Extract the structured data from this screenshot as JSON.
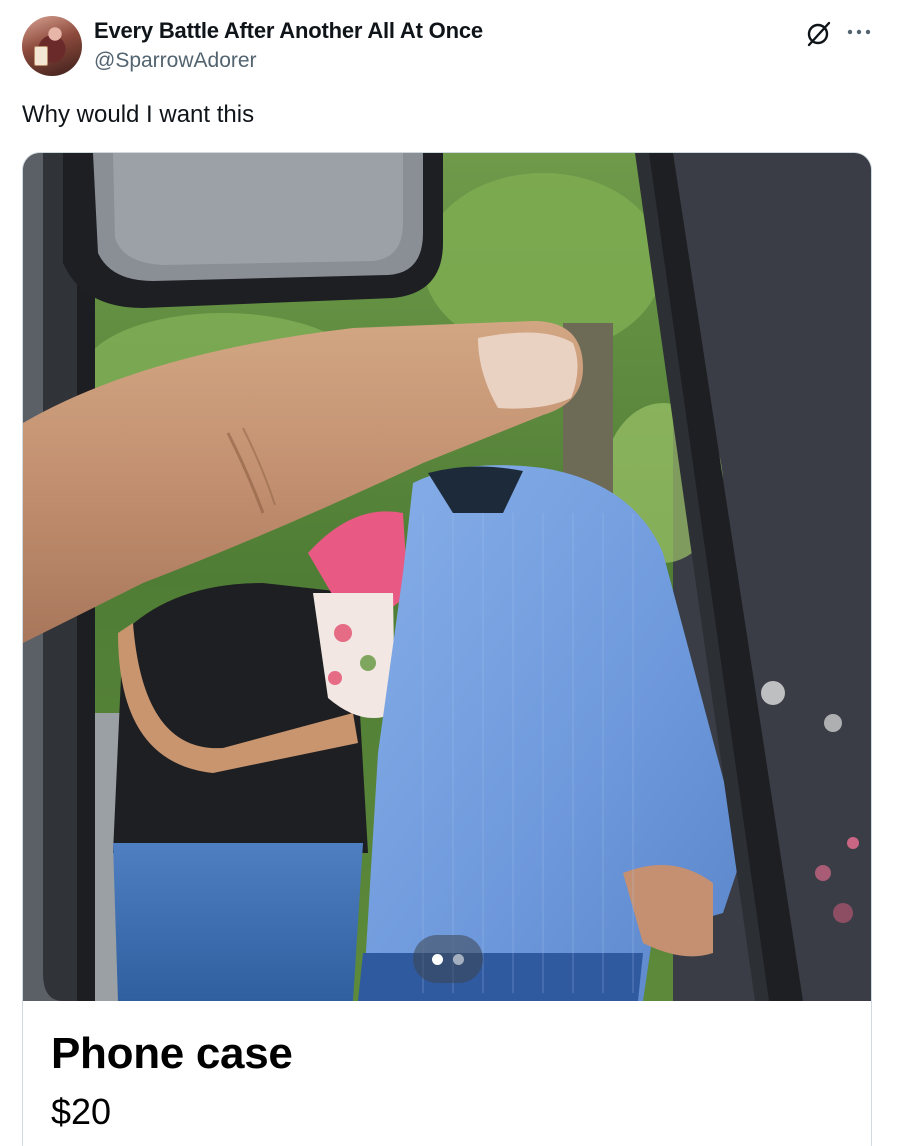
{
  "user": {
    "display_name": "Every Battle After Another All At Once",
    "handle": "@SparrowAdorer"
  },
  "icons": {
    "grok": "grok-icon",
    "more": "more-options-icon"
  },
  "post": {
    "text": "Why would I want this"
  },
  "media": {
    "pager": {
      "total": 2,
      "current": 1
    }
  },
  "listing": {
    "title": "Phone case",
    "price": "$20"
  },
  "colors": {
    "text_primary": "#0f1419",
    "text_secondary": "#536471",
    "border": "#cfd9de"
  }
}
